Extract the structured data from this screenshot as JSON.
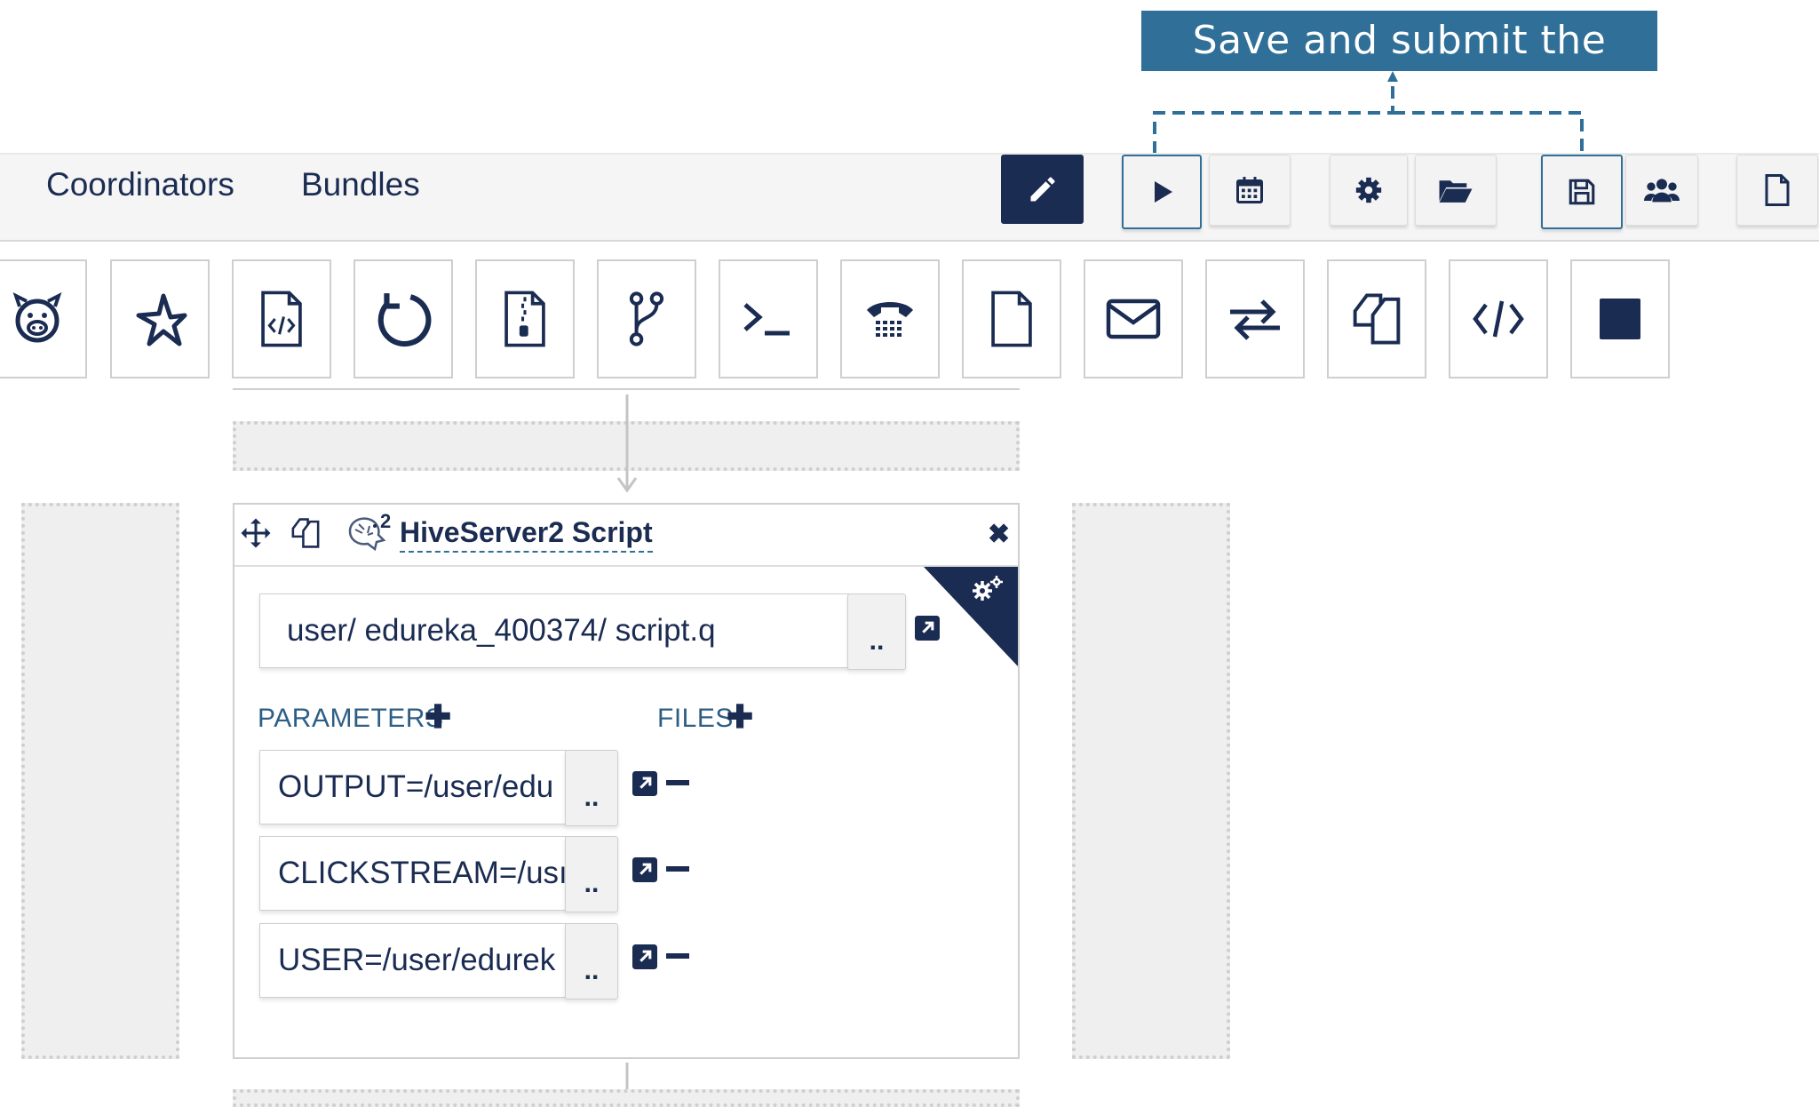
{
  "callout": {
    "text": "Save and submit the action",
    "color": "#2f6f98"
  },
  "nav": {
    "coordinators": "Coordinators",
    "bundles": "Bundles"
  },
  "toolbar": {
    "buttons": [
      "edit-icon",
      "play-icon",
      "calendar-icon",
      "gear-icon",
      "folder-open-icon",
      "save-icon",
      "users-icon",
      "file-icon"
    ]
  },
  "actions_palette": {
    "icons": [
      "pig-icon",
      "spark-star-icon",
      "hive-script-icon",
      "refresh-icon",
      "zip-file-icon",
      "git-branch-icon",
      "terminal-icon",
      "phone-icon",
      "file-icon",
      "envelope-icon",
      "exchange-icon",
      "copy-icon",
      "code-icon",
      "stop-square-icon"
    ]
  },
  "action_card": {
    "badge": "2",
    "title": "HiveServer2 Script",
    "script_path": "user/ edureka_400374/ script.q",
    "browse_label": "..",
    "parameters_label": "PARAMETERS",
    "files_label": "FILES",
    "plus": "✚",
    "minus": "−",
    "close": "✖",
    "parameters": [
      {
        "value": "OUTPUT=/user/edu"
      },
      {
        "value": "CLICKSTREAM=/usı"
      },
      {
        "value": "USER=/user/edurek"
      }
    ]
  },
  "colors": {
    "navy": "#1b2c52",
    "accent": "#2f6f98"
  }
}
